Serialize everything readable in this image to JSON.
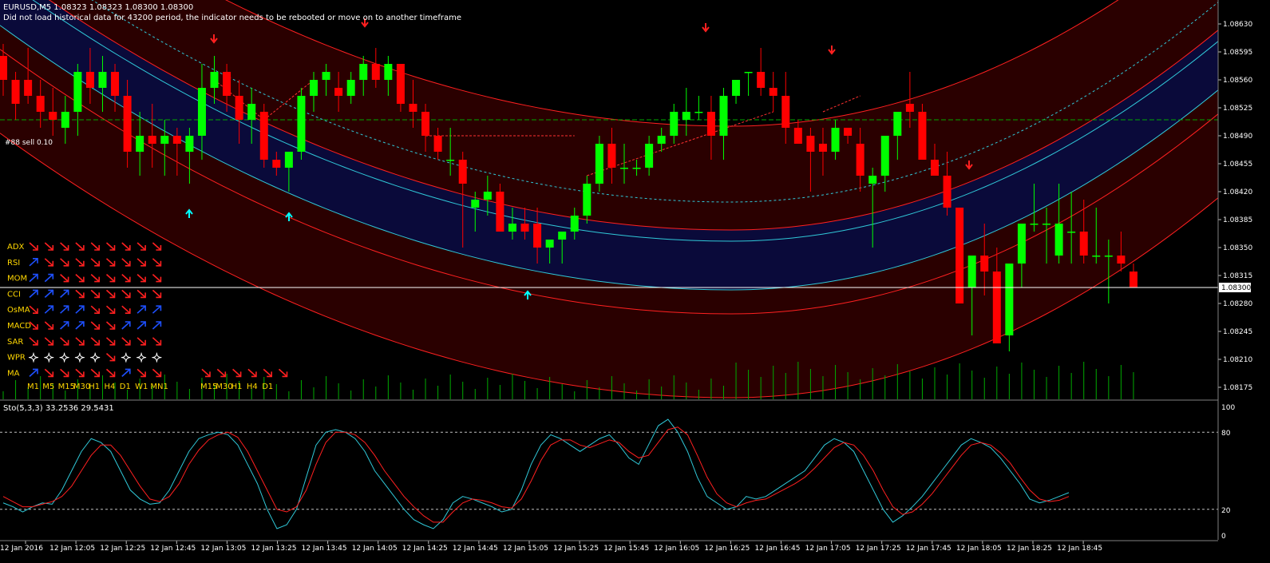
{
  "header": {
    "title": "EURUSD,M5  1.08323 1.08323 1.08300 1.08300",
    "warning": "Did not load historical data for 43200 period, the indicator needs to be rebooted or move on to another timeframe"
  },
  "order_label": "#88 sell 0.10",
  "colors": {
    "background": "#000000",
    "bull": "#00ff00",
    "bear": "#ff0000",
    "band_outer": "#2a0000",
    "band_inner": "#0a0a3a",
    "band_line_red": "#ff2020",
    "band_line_cyan": "#30c8d8",
    "dashed": "#30c8d8",
    "grid": "#c0c0c0",
    "axis_text": "#ffffff",
    "indicator_label": "#ffd700",
    "arrow_up_cyan": "#00ffff",
    "arrow_down_red": "#ff2020",
    "arrow_up_blue": "#1e50ff",
    "stoch_main": "#30c8d8",
    "stoch_signal": "#ff2020",
    "volume": "#00aa00",
    "order_line": "#00aa00"
  },
  "signal_panel": {
    "rows": [
      {
        "name": "ADX",
        "cells": [
          "dr",
          "dr",
          "dr",
          "dr",
          "dr",
          "dr",
          "dr",
          "dr",
          "dr"
        ]
      },
      {
        "name": "RSI",
        "cells": [
          "ub",
          "dr",
          "dr",
          "dr",
          "dr",
          "dr",
          "dr",
          "dr",
          "dr"
        ]
      },
      {
        "name": "MOM",
        "cells": [
          "ub",
          "ub",
          "dr",
          "dr",
          "dr",
          "dr",
          "dr",
          "dr",
          "dr"
        ]
      },
      {
        "name": "CCI",
        "cells": [
          "ub",
          "ub",
          "ub",
          "dr",
          "dr",
          "dr",
          "dr",
          "dr",
          "dr"
        ]
      },
      {
        "name": "OsMA",
        "cells": [
          "dr",
          "ub",
          "ub",
          "ub",
          "dr",
          "dr",
          "dr",
          "ub",
          "ub"
        ]
      },
      {
        "name": "MACD",
        "cells": [
          "dr",
          "dr",
          "ub",
          "ub",
          "dr",
          "dr",
          "ub",
          "ub",
          "ub"
        ]
      },
      {
        "name": "SAR",
        "cells": [
          "dr",
          "dr",
          "dr",
          "dr",
          "dr",
          "dr",
          "dr",
          "dr",
          "dr"
        ]
      },
      {
        "name": "WPR",
        "cells": [
          "st",
          "st",
          "st",
          "st",
          "st",
          "dr",
          "st",
          "st",
          "st"
        ]
      },
      {
        "name": "MA",
        "cells": [
          "ub",
          "dr",
          "dr",
          "dr",
          "dr",
          "dr",
          "ub",
          "dr",
          "dr"
        ]
      }
    ],
    "extra_ma": [
      "dr",
      "dr",
      "dr",
      "dr",
      "dr",
      "dr"
    ],
    "tf_labels": [
      "M1",
      "M5",
      "M15",
      "M30",
      "H1",
      "H4",
      "D1",
      "W1",
      "MN1"
    ],
    "tf_labels_2": [
      "M15",
      "M30",
      "H1",
      "H4",
      "D1"
    ]
  },
  "chart_data": [
    {
      "type": "candlestick",
      "title": "EURUSD,M5",
      "ylim": [
        1.0816,
        1.0866
      ],
      "y_ticks": [
        "1.08630",
        "1.08595",
        "1.08560",
        "1.08525",
        "1.08490",
        "1.08455",
        "1.08420",
        "1.08385",
        "1.08350",
        "1.08315",
        "1.08280",
        "1.08245",
        "1.08210",
        "1.08175"
      ],
      "current_price": "1.08300",
      "order_level": 1.0851,
      "x_labels": [
        "12 Jan 2016",
        "12 Jan 12:05",
        "12 Jan 12:25",
        "12 Jan 12:45",
        "12 Jan 13:05",
        "12 Jan 13:25",
        "12 Jan 13:45",
        "12 Jan 14:05",
        "12 Jan 14:25",
        "12 Jan 14:45",
        "12 Jan 15:05",
        "12 Jan 15:25",
        "12 Jan 15:45",
        "12 Jan 16:05",
        "12 Jan 16:25",
        "12 Jan 16:45",
        "12 Jan 17:05",
        "12 Jan 17:25",
        "12 Jan 17:45",
        "12 Jan 18:05",
        "12 Jan 18:25",
        "12 Jan 18:45"
      ],
      "candles": [
        [
          1.0859,
          1.08605,
          1.0854,
          1.0856
        ],
        [
          1.0856,
          1.0857,
          1.0851,
          1.0853
        ],
        [
          1.0856,
          1.086,
          1.0853,
          1.0854
        ],
        [
          1.0854,
          1.0856,
          1.085,
          1.0852
        ],
        [
          1.0852,
          1.0855,
          1.0849,
          1.0851
        ],
        [
          1.085,
          1.0854,
          1.0848,
          1.0852
        ],
        [
          1.0852,
          1.0858,
          1.0849,
          1.0857
        ],
        [
          1.0857,
          1.086,
          1.0853,
          1.0855
        ],
        [
          1.0855,
          1.0859,
          1.0852,
          1.0857
        ],
        [
          1.0857,
          1.0858,
          1.0852,
          1.0854
        ],
        [
          1.0854,
          1.0856,
          1.0845,
          1.0847
        ],
        [
          1.0847,
          1.0852,
          1.0844,
          1.0849
        ],
        [
          1.0849,
          1.0853,
          1.0845,
          1.0848
        ],
        [
          1.0848,
          1.0851,
          1.0844,
          1.0849
        ],
        [
          1.0849,
          1.085,
          1.0844,
          1.0848
        ],
        [
          1.0847,
          1.085,
          1.0843,
          1.0849
        ],
        [
          1.0849,
          1.0858,
          1.0846,
          1.0855
        ],
        [
          1.0855,
          1.0859,
          1.0853,
          1.0857
        ],
        [
          1.0857,
          1.0858,
          1.0852,
          1.0854
        ],
        [
          1.0854,
          1.0856,
          1.0848,
          1.0851
        ],
        [
          1.0851,
          1.0855,
          1.0848,
          1.0853
        ],
        [
          1.0852,
          1.0853,
          1.0845,
          1.0846
        ],
        [
          1.0846,
          1.0847,
          1.0844,
          1.0845
        ],
        [
          1.0845,
          1.0847,
          1.0842,
          1.0847
        ],
        [
          1.0847,
          1.0855,
          1.0846,
          1.0854
        ],
        [
          1.0854,
          1.0857,
          1.0852,
          1.0856
        ],
        [
          1.0856,
          1.0858,
          1.0854,
          1.0857
        ],
        [
          1.0855,
          1.0857,
          1.0852,
          1.0854
        ],
        [
          1.0854,
          1.0857,
          1.0853,
          1.0856
        ],
        [
          1.0856,
          1.0859,
          1.0854,
          1.0858
        ],
        [
          1.0858,
          1.086,
          1.0855,
          1.0856
        ],
        [
          1.0856,
          1.0859,
          1.0854,
          1.0858
        ],
        [
          1.0858,
          1.0858,
          1.0852,
          1.0853
        ],
        [
          1.0853,
          1.0856,
          1.085,
          1.0852
        ],
        [
          1.0852,
          1.0853,
          1.0847,
          1.0849
        ],
        [
          1.0849,
          1.085,
          1.0846,
          1.0847
        ],
        [
          1.0846,
          1.085,
          1.0844,
          1.0846
        ],
        [
          1.0846,
          1.0847,
          1.0835,
          1.0843
        ],
        [
          1.084,
          1.0842,
          1.0837,
          1.0841
        ],
        [
          1.0841,
          1.0844,
          1.0839,
          1.0842
        ],
        [
          1.0842,
          1.0843,
          1.0837,
          1.0837
        ],
        [
          1.0837,
          1.084,
          1.0836,
          1.0838
        ],
        [
          1.0838,
          1.084,
          1.0836,
          1.0837
        ],
        [
          1.0838,
          1.084,
          1.0833,
          1.0835
        ],
        [
          1.0835,
          1.0836,
          1.0833,
          1.0836
        ],
        [
          1.0836,
          1.0837,
          1.0833,
          1.0837
        ],
        [
          1.0837,
          1.084,
          1.0836,
          1.0839
        ],
        [
          1.0839,
          1.0844,
          1.0838,
          1.0843
        ],
        [
          1.0843,
          1.0849,
          1.0842,
          1.0848
        ],
        [
          1.0848,
          1.085,
          1.0843,
          1.0845
        ],
        [
          1.0845,
          1.0848,
          1.0843,
          1.0845
        ],
        [
          1.0845,
          1.0846,
          1.0844,
          1.0845
        ],
        [
          1.0845,
          1.0849,
          1.0844,
          1.0848
        ],
        [
          1.0848,
          1.085,
          1.0847,
          1.0849
        ],
        [
          1.0849,
          1.0853,
          1.0848,
          1.0852
        ],
        [
          1.0851,
          1.0855,
          1.0849,
          1.0852
        ],
        [
          1.0852,
          1.0854,
          1.0851,
          1.0852
        ],
        [
          1.0852,
          1.0854,
          1.0846,
          1.0849
        ],
        [
          1.0849,
          1.0855,
          1.0846,
          1.0854
        ],
        [
          1.0854,
          1.0856,
          1.0853,
          1.0856
        ],
        [
          1.0857,
          1.0857,
          1.0854,
          1.0857
        ],
        [
          1.0857,
          1.086,
          1.0854,
          1.0855
        ],
        [
          1.0855,
          1.0857,
          1.0852,
          1.0854
        ],
        [
          1.0854,
          1.0857,
          1.0848,
          1.085
        ],
        [
          1.085,
          1.0851,
          1.0848,
          1.0848
        ],
        [
          1.0849,
          1.085,
          1.0842,
          1.0847
        ],
        [
          1.0848,
          1.085,
          1.0844,
          1.0847
        ],
        [
          1.0847,
          1.0851,
          1.0846,
          1.085
        ],
        [
          1.085,
          1.085,
          1.0848,
          1.0849
        ],
        [
          1.0848,
          1.085,
          1.0842,
          1.0844
        ],
        [
          1.0843,
          1.0845,
          1.0835,
          1.0844
        ],
        [
          1.0844,
          1.0848,
          1.0842,
          1.0849
        ],
        [
          1.0849,
          1.0852,
          1.0846,
          1.0852
        ],
        [
          1.0853,
          1.0857,
          1.085,
          1.0852
        ],
        [
          1.0852,
          1.0853,
          1.0846,
          1.0846
        ],
        [
          1.0846,
          1.0848,
          1.0844,
          1.0844
        ],
        [
          1.0844,
          1.0847,
          1.0839,
          1.084
        ],
        [
          1.084,
          1.084,
          1.0828,
          1.0828
        ],
        [
          1.083,
          1.0834,
          1.0824,
          1.0834
        ],
        [
          1.0834,
          1.0838,
          1.0829,
          1.0832
        ],
        [
          1.0832,
          1.0835,
          1.0823,
          1.0823
        ],
        [
          1.0824,
          1.0833,
          1.0822,
          1.0833
        ],
        [
          1.0833,
          1.0838,
          1.083,
          1.0838
        ],
        [
          1.0838,
          1.0843,
          1.0837,
          1.0838
        ],
        [
          1.0838,
          1.084,
          1.0833,
          1.0838
        ],
        [
          1.0834,
          1.0843,
          1.0833,
          1.0838
        ],
        [
          1.0837,
          1.0842,
          1.0833,
          1.0837
        ],
        [
          1.0837,
          1.0841,
          1.0833,
          1.0834
        ],
        [
          1.0834,
          1.084,
          1.0833,
          1.0834
        ],
        [
          1.0834,
          1.0836,
          1.0828,
          1.0834
        ],
        [
          1.0834,
          1.0837,
          1.0832,
          1.0833
        ],
        [
          1.0832,
          1.0833,
          1.083,
          1.083
        ]
      ]
    },
    {
      "type": "line",
      "title": "Sto(5,3,3) 33.2536 29.5431",
      "ylim": [
        0,
        100
      ],
      "y_ticks": [
        "100",
        "80",
        "20",
        "0"
      ],
      "levels": [
        80,
        20
      ],
      "series": [
        {
          "values": [
            25,
            22,
            18,
            22,
            25,
            24,
            35,
            50,
            65,
            75,
            72,
            65,
            50,
            35,
            28,
            24,
            25,
            35,
            50,
            65,
            75,
            78,
            80,
            78,
            70,
            55,
            40,
            20,
            5,
            8,
            20,
            45,
            70,
            80,
            82,
            80,
            75,
            65,
            50,
            40,
            30,
            20,
            12,
            8,
            5,
            12,
            25,
            30,
            28,
            25,
            22,
            18,
            20,
            35,
            55,
            70,
            78,
            75,
            70,
            65,
            70,
            75,
            78,
            70,
            60,
            55,
            70,
            85,
            90,
            80,
            65,
            45,
            30,
            25,
            20,
            22,
            30,
            28,
            30,
            35,
            40,
            45,
            50,
            60,
            70,
            75,
            72,
            65,
            50,
            35,
            20,
            10,
            15,
            22,
            30,
            40,
            50,
            60,
            70,
            75,
            72,
            68,
            60,
            50,
            40,
            28,
            25,
            27,
            30,
            33
          ]
        },
        {
          "values": [
            30,
            26,
            22,
            22,
            24,
            26,
            30,
            38,
            50,
            62,
            70,
            70,
            62,
            50,
            38,
            28,
            26,
            30,
            40,
            55,
            66,
            74,
            78,
            80,
            76,
            65,
            50,
            35,
            20,
            18,
            22,
            35,
            55,
            72,
            80,
            80,
            78,
            72,
            62,
            50,
            40,
            30,
            22,
            15,
            10,
            10,
            18,
            25,
            28,
            27,
            25,
            22,
            21,
            28,
            42,
            58,
            70,
            74,
            74,
            70,
            68,
            71,
            74,
            72,
            65,
            60,
            62,
            72,
            82,
            84,
            78,
            62,
            45,
            32,
            25,
            22,
            25,
            27,
            28,
            32,
            36,
            40,
            45,
            52,
            60,
            68,
            72,
            70,
            62,
            50,
            35,
            22,
            16,
            18,
            24,
            32,
            42,
            52,
            62,
            70,
            72,
            70,
            64,
            56,
            45,
            35,
            28,
            26,
            27,
            30
          ]
        }
      ]
    }
  ]
}
